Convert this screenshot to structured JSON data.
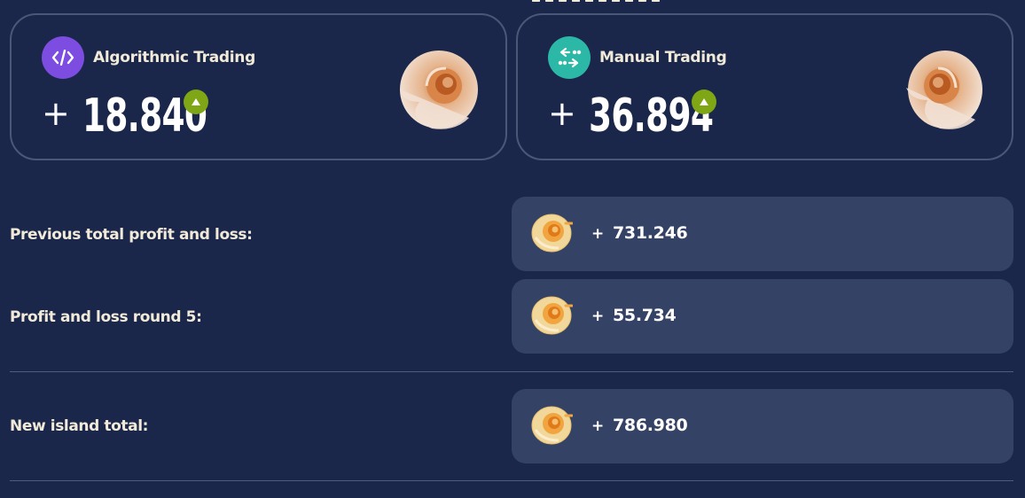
{
  "cards": [
    {
      "title": "Algorithmic Trading",
      "sign": "+",
      "value": "18.840",
      "icon": "code-icon",
      "icon_color": "#7c4de0",
      "trend": "up"
    },
    {
      "title": "Manual Trading",
      "sign": "+",
      "value": "36.894",
      "icon": "swap-icon",
      "icon_color": "#2cb8a6",
      "trend": "up"
    }
  ],
  "rows": [
    {
      "label": "Previous total profit and loss:",
      "sign": "+",
      "value": "731.246"
    },
    {
      "label": "Profit and loss round 5:",
      "sign": "+",
      "value": "55.734"
    },
    {
      "label": "New island total:",
      "sign": "+",
      "value": "786.980"
    }
  ],
  "colors": {
    "background": "#1a274a",
    "value_box": "#344265",
    "trend_up": "#7fa614",
    "label_text": "#f1ead8"
  }
}
